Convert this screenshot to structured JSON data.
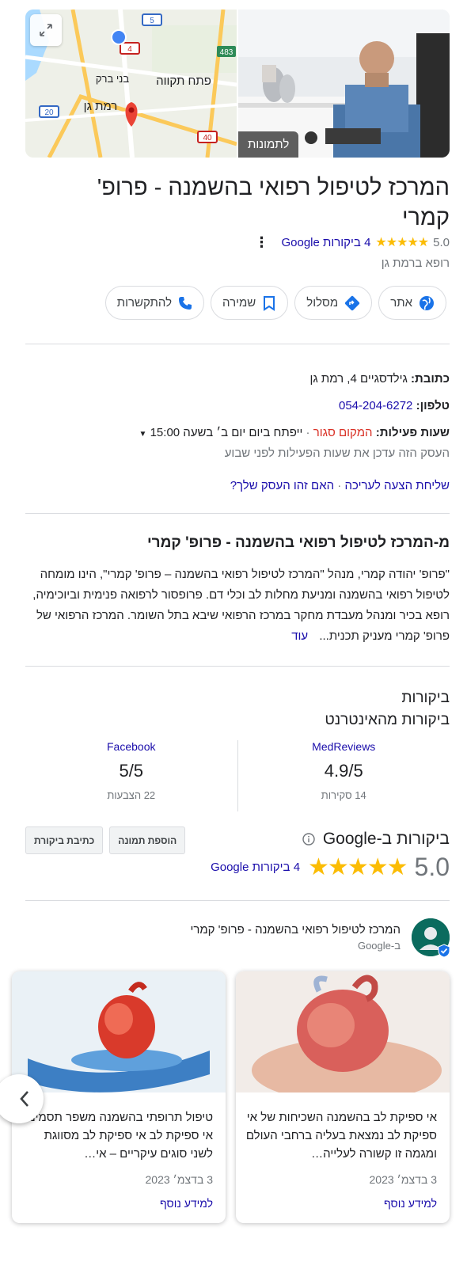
{
  "media": {
    "photos_label": "לתמונות",
    "map_labels": [
      "פתח תקווה",
      "בני ברק",
      "רמת גן"
    ],
    "road_shields": [
      "5",
      "4",
      "483",
      "20",
      "40"
    ]
  },
  "business": {
    "title": "המרכז לטיפול רפואי בהשמנה - פרופ' קמרי",
    "rating": "5.0",
    "stars": "★★★★★",
    "reviews_link": "4 ביקורות Google",
    "category": "רופא ברמת גן"
  },
  "actions": {
    "website": "אתר",
    "directions": "מסלול",
    "save": "שמירה",
    "call": "להתקשרות"
  },
  "info": {
    "address_label": "כתובת:",
    "address": "גילדסגיים 4, רמת גן",
    "phone_label": "טלפון:",
    "phone": "054-204-6272",
    "hours_label": "שעות פעילות:",
    "hours_status": "המקום סגור",
    "hours_next": "ייפתח ביום יום ב׳ בשעה 15:00",
    "hours_note": "העסק הזה עדכן את שעות הפעילות לפני שבוע",
    "suggest_edit": "שליחת הצעה לעריכה",
    "own_business": "האם זהו העסק שלך?"
  },
  "about": {
    "title": "מ-המרכז לטיפול רפואי בהשמנה - פרופ' קמרי",
    "text": "\"פרופ' יהודה קמרי, מנהל \"המרכז לטיפול רפואי בהשמנה – פרופ' קמרי\", הינו מומחה לטיפול רפואי בהשמנה ומניעת מחלות לב וכלי דם. פרופסור לרפואה פנימית וביוכימיה, רופא בכיר ומנהל מעבדת מחקר במרכז הרפואי שיבא בתל השומר. המרכז הרפואי של פרופ' קמרי מעניק תכנית...",
    "more": "עוד"
  },
  "reviews": {
    "heading": "ביקורות",
    "web_heading": "ביקורות מהאינטרנט",
    "web": [
      {
        "source": "MedReviews",
        "score": "4.9/5",
        "count": "14 סקירות"
      },
      {
        "source": "Facebook",
        "score": "5/5",
        "count": "22 הצבעות"
      }
    ],
    "google_title": "ביקורות ב-Google",
    "write_review": "כתיבת ביקורת",
    "add_photo": "הוספת תמונה",
    "google_rating": "5.0",
    "google_stars": "★★★★★",
    "google_link": "4 ביקורות Google"
  },
  "posts": {
    "author": "המרכז לטיפול רפואי בהשמנה - פרופ' קמרי",
    "via": "ב-Google",
    "items": [
      {
        "text": "אי ספיקת לב בהשמנה השכיחות של אי ספיקת לב נמצאת בעליה ברחבי העולם ומגמה זו קשורה לעלייה…",
        "date": "3 בדצמ׳ 2023",
        "more": "למידע נוסף"
      },
      {
        "text": "טיפול תרופתי בהשמנה משפר תסמיני אי ספיקת לב אי ספיקת לב מסווגת לשני סוגים עיקריים – אי…",
        "date": "3 בדצמ׳ 2023",
        "more": "למידע נוסף"
      }
    ]
  },
  "colors": {
    "link": "#1a0dab",
    "star": "#fbbc04",
    "closed": "#d93025",
    "muted": "#70757a"
  }
}
